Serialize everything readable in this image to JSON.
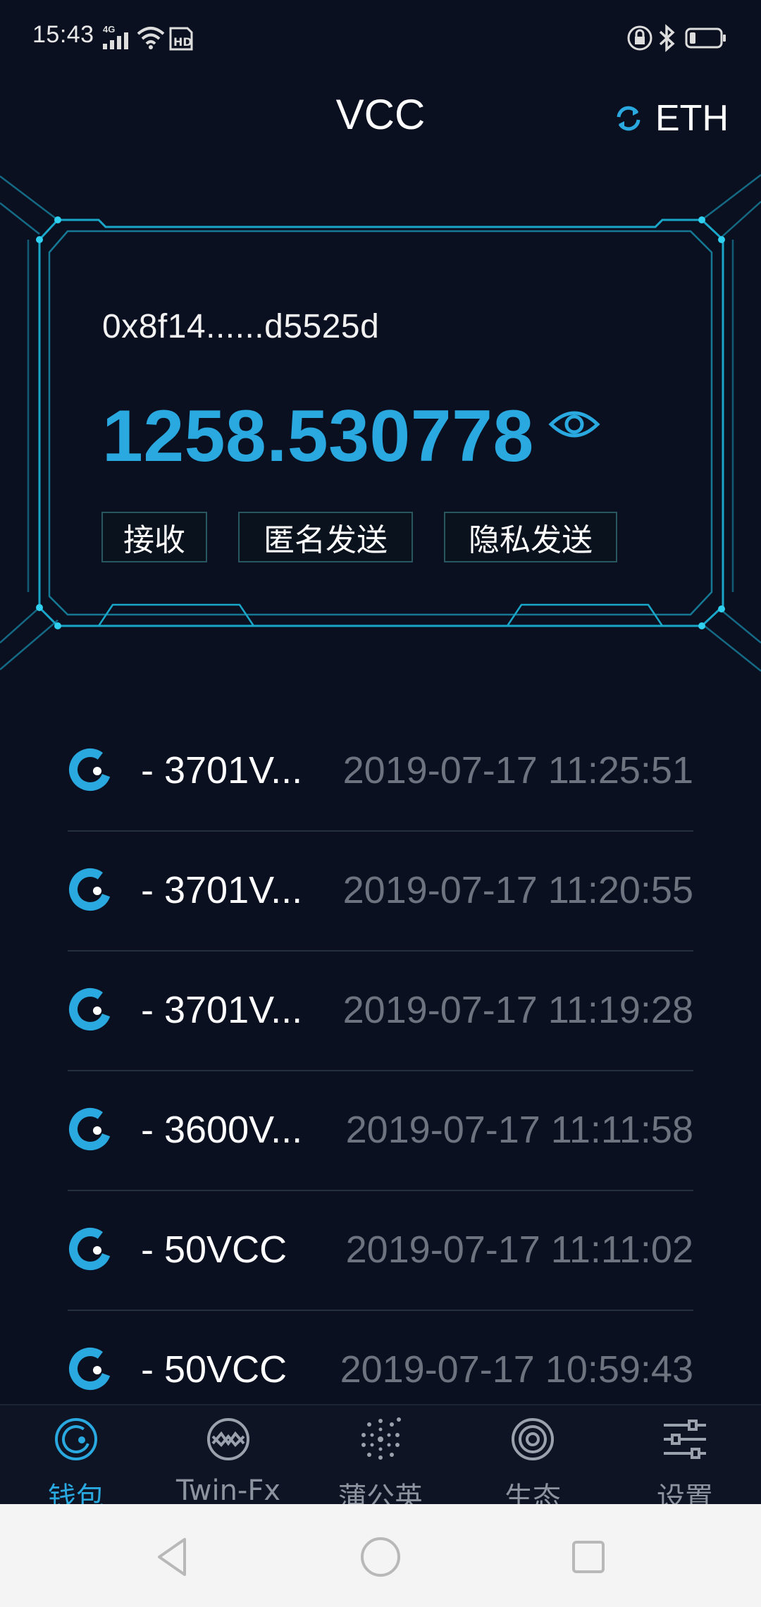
{
  "status_bar": {
    "time": "15:43",
    "network": "4G",
    "icons": [
      "signal-icon",
      "wifi-icon",
      "hd-icon",
      "lock-icon",
      "bluetooth-icon",
      "battery-icon"
    ]
  },
  "header": {
    "title": "VCC",
    "currency": "ETH"
  },
  "wallet": {
    "address": "0x8f14......d5525d",
    "balance": "1258.530778",
    "buttons": {
      "receive": "接收",
      "anonymous_send": "匿名发送",
      "private_send": "隐私发送"
    }
  },
  "transactions": [
    {
      "amount": "- 3701V...",
      "time": "2019-07-17 11:25:51"
    },
    {
      "amount": "- 3701V...",
      "time": "2019-07-17 11:20:55"
    },
    {
      "amount": "- 3701V...",
      "time": "2019-07-17 11:19:28"
    },
    {
      "amount": "- 3600V...",
      "time": "2019-07-17 11:11:58"
    },
    {
      "amount": "- 50VCC",
      "time": "2019-07-17 11:11:02"
    },
    {
      "amount": "- 50VCC",
      "time": "2019-07-17 10:59:43"
    }
  ],
  "tabs": [
    {
      "label": "钱包",
      "icon": "wallet-icon",
      "active": true
    },
    {
      "label": "Twin-Fx",
      "icon": "twin-fx-icon",
      "active": false
    },
    {
      "label": "蒲公英",
      "icon": "dandelion-icon",
      "active": false
    },
    {
      "label": "生态",
      "icon": "ecosystem-icon",
      "active": false
    },
    {
      "label": "设置",
      "icon": "settings-icon",
      "active": false
    }
  ],
  "colors": {
    "background": "#0b1020",
    "accent": "#29a9e0",
    "frame": "#1aa6c8",
    "muted_text": "#6d7480"
  }
}
